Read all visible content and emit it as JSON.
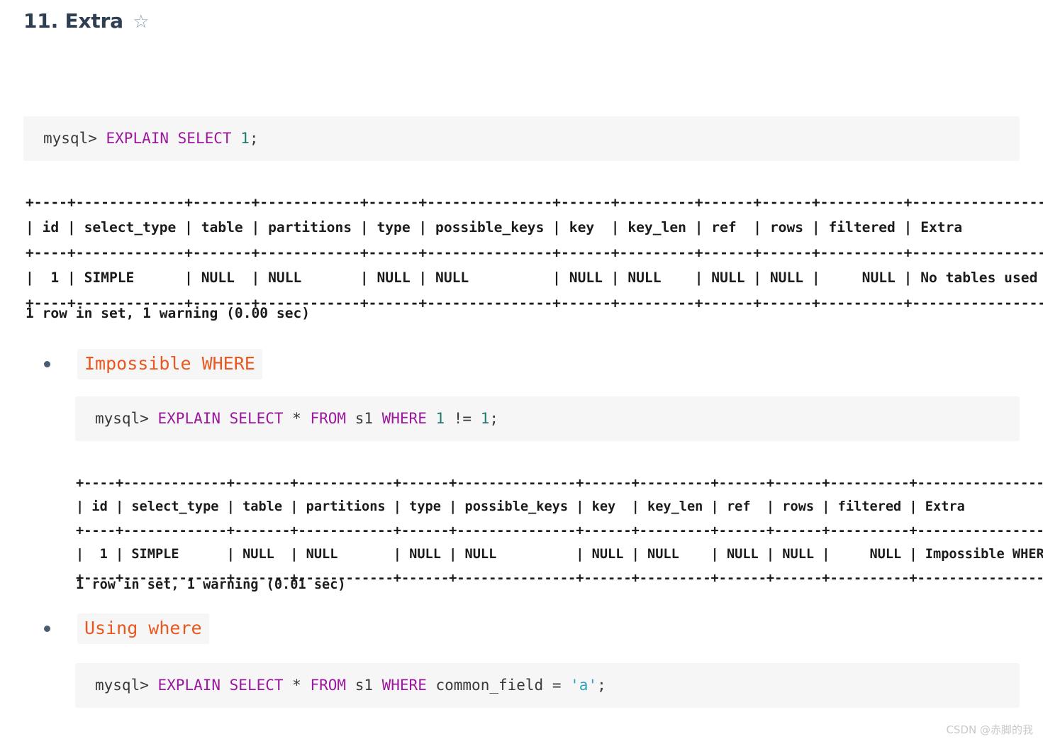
{
  "page": {
    "heading": "11. Extra",
    "star_icon": "☆",
    "watermark": "CSDN @赤脚的我"
  },
  "code_blocks": {
    "block1": {
      "prompt": "mysql> ",
      "keyword1": "EXPLAIN SELECT",
      "space": " ",
      "number": "1",
      "semicolon": ";",
      "full_text": "mysql> EXPLAIN SELECT 1;"
    },
    "block2": {
      "prompt": "mysql> ",
      "keyword1": "EXPLAIN SELECT",
      "star": " * ",
      "keyword2": "FROM",
      "table": " s1 ",
      "keyword3": "WHERE",
      "num1": " 1",
      "op": " != ",
      "num2": "1",
      "semicolon": ";",
      "full_text": "mysql> EXPLAIN SELECT * FROM s1 WHERE 1 != 1;"
    },
    "block3": {
      "prompt": "mysql> ",
      "keyword1": "EXPLAIN SELECT",
      "star": " * ",
      "keyword2": "FROM",
      "table": " s1 ",
      "keyword3": "WHERE",
      "column": " common_field ",
      "op": "= ",
      "value": "'a'",
      "semicolon": ";",
      "full_text": "mysql> EXPLAIN SELECT * FROM s1 WHERE common_field = 'a';"
    }
  },
  "result_tables": {
    "table1": {
      "columns": [
        "id",
        "select_type",
        "table",
        "partitions",
        "type",
        "possible_keys",
        "key",
        "key_len",
        "ref",
        "rows",
        "filtered",
        "Extra"
      ],
      "rows": [
        [
          "1",
          "SIMPLE",
          "NULL",
          "NULL",
          "NULL",
          "NULL",
          "NULL",
          "NULL",
          "NULL",
          "NULL",
          "NULL",
          "No tables used"
        ]
      ],
      "status": "1 row in set, 1 warning (0.00 sec)",
      "ascii": "+----+-------------+-------+------------+------+---------------+------+---------+------+------+----------+----------------+\n| id | select_type | table | partitions | type | possible_keys | key  | key_len | ref  | rows | filtered | Extra          |\n+----+-------------+-------+------------+------+---------------+------+---------+------+------+----------+----------------+\n|  1 | SIMPLE      | NULL  | NULL       | NULL | NULL          | NULL | NULL    | NULL | NULL |     NULL | No tables used |\n+----+-------------+-------+------------+------+---------------+------+---------+------+------+----------+----------------+"
    },
    "table2": {
      "columns": [
        "id",
        "select_type",
        "table",
        "partitions",
        "type",
        "possible_keys",
        "key",
        "key_len",
        "ref",
        "rows",
        "filtered",
        "Extra"
      ],
      "rows": [
        [
          "1",
          "SIMPLE",
          "NULL",
          "NULL",
          "NULL",
          "NULL",
          "NULL",
          "NULL",
          "NULL",
          "NULL",
          "NULL",
          "Impossible WHERE"
        ]
      ],
      "status": "1 row in set, 1 warning (0.01 sec)",
      "ascii": "+----+-------------+-------+------------+------+---------------+------+---------+------+------+----------+------------------+\n| id | select_type | table | partitions | type | possible_keys | key  | key_len | ref  | rows | filtered | Extra            |\n+----+-------------+-------+------------+------+---------------+------+---------+------+------+----------+------------------+\n|  1 | SIMPLE      | NULL  | NULL       | NULL | NULL          | NULL | NULL    | NULL | NULL |     NULL | Impossible WHERE |\n+----+-------------+-------+------------+------+---------------+------+---------+------+------+----------+------------------+"
    }
  },
  "bullets": [
    {
      "label": "Impossible WHERE"
    },
    {
      "label": "Using where"
    }
  ],
  "colors": {
    "keyword": "#9b179e",
    "number": "#1f7a6e",
    "string": "#29a3c0",
    "inline_code_text": "#e8581f",
    "code_bg": "#f6f6f7",
    "heading": "#2e3f52"
  }
}
